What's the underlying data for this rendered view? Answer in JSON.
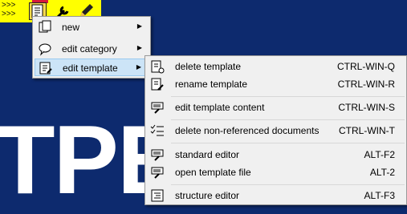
{
  "background": {
    "letters": "TPE",
    "watermark": ""
  },
  "toolbar": {
    "arrows": [
      ">>>",
      ">>>"
    ],
    "icons": [
      "template-icon",
      "wrench-icon",
      "pencil-icon"
    ]
  },
  "menu_main": {
    "items": [
      {
        "label": "new",
        "icon": "new-document-icon",
        "has_submenu": true
      },
      {
        "label": "edit category",
        "icon": "speech-bubble-icon",
        "has_submenu": true
      },
      {
        "label": "edit template",
        "icon": "edit-template-icon",
        "has_submenu": true,
        "highlighted": true
      }
    ]
  },
  "menu_template": {
    "items": [
      {
        "label": "delete template",
        "shortcut": "CTRL-WIN-Q",
        "icon": "delete-template-icon"
      },
      {
        "label": "rename template",
        "shortcut": "CTRL-WIN-R",
        "icon": "rename-template-icon"
      },
      {
        "label": "edit template content",
        "shortcut": "CTRL-WIN-S",
        "icon": "edit-content-icon"
      },
      {
        "label": "delete non-referenced documents",
        "shortcut": "CTRL-WIN-T",
        "icon": "checklist-icon"
      },
      {
        "label": "standard editor",
        "shortcut": "ALT-F2",
        "icon": "editor-icon"
      },
      {
        "label": "open template file",
        "shortcut": "ALT-2",
        "icon": "open-file-icon"
      },
      {
        "label": "structure editor",
        "shortcut": "ALT-F3",
        "icon": "structure-icon"
      }
    ]
  },
  "colors": {
    "background": "#0d2a6e",
    "toolbar": "#ffff00",
    "highlight": "#cce4f7"
  }
}
